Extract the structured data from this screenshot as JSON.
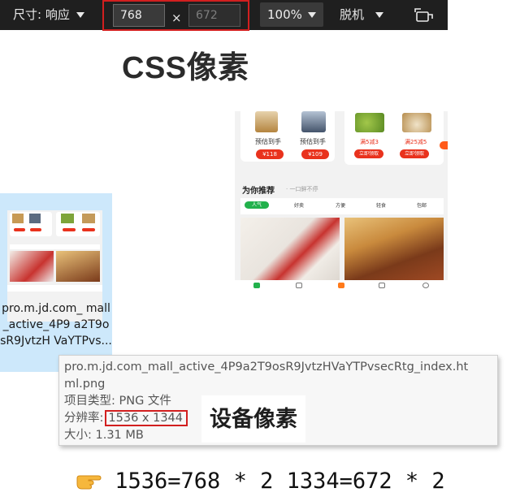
{
  "toolbar": {
    "device_mode_label": "尺寸: 响应",
    "width_value": "768",
    "times_symbol": "×",
    "height_placeholder": "672",
    "zoom_label": "100%",
    "throttle_label": "脱机",
    "rotate_icon": "rotate-device-icon",
    "accent_color": "#d21f1f"
  },
  "heading": {
    "title": "CSS像素"
  },
  "preview": {
    "product_cards": [
      {
        "label": "预估到手",
        "price": "¥118"
      },
      {
        "label": "预估到手",
        "price": "¥109"
      }
    ],
    "coupons": [
      {
        "label": "满5减3",
        "button": "立即领取"
      },
      {
        "label": "满25减5",
        "button": "立即领取"
      }
    ],
    "recommend_title": "为你推荐",
    "recommend_subtitle": "· 一口鲜不停",
    "tabs": [
      {
        "label": "人气"
      },
      {
        "label": "好卖"
      },
      {
        "label": "方便"
      },
      {
        "label": "轻食"
      },
      {
        "label": "包邮"
      }
    ],
    "brand_color": "#e9321d",
    "green_color": "#22b14c"
  },
  "file": {
    "name": "pro.m.jd.com_mall_active_4P9a2T9osR9JvtzHVaYTPvsecRtg_index.png",
    "name_visible": "pro.m.jd.com_ mall_active_4P9 a2T9osR9JvtzH VaYTPvs...",
    "highlight_color": "#cde8fb"
  },
  "tooltip": {
    "filename_line1": "pro.m.jd.com_mall_active_4P9a2T9osR9JvtzHVaYTPvsecRtg_index.ht",
    "filename_line2": "ml.png",
    "type_label": "项目类型: PNG 文件",
    "resolution_label": "分辨率:",
    "resolution_value": "1536 x 1344",
    "size_label": "大小: 1.31 MB",
    "device_pixel_label": "设备像素"
  },
  "formula": {
    "pointer_icon": "pointing-hand-icon",
    "text": "1536=768 * 2 1334=672 * 2"
  }
}
